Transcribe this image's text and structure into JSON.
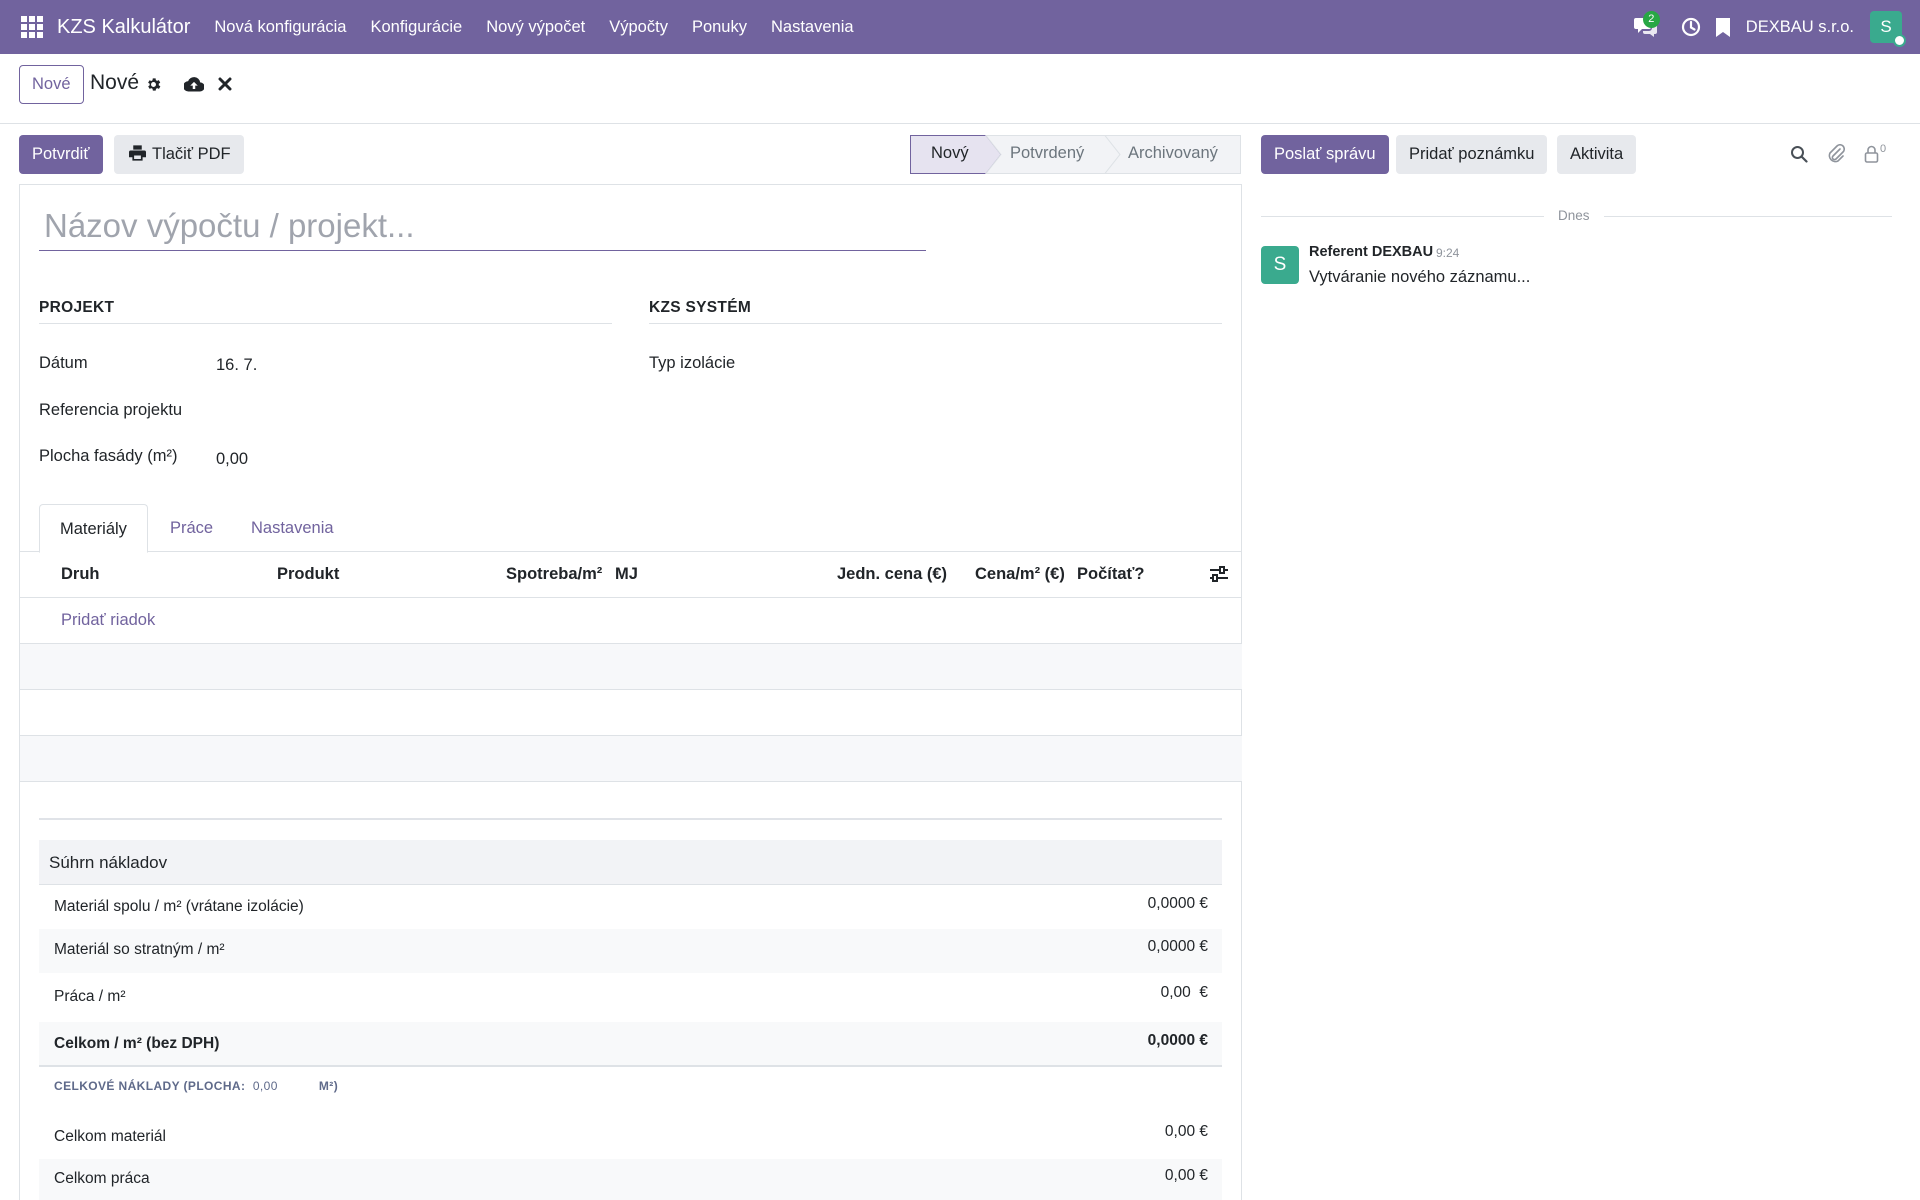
{
  "navbar": {
    "brand": "KZS Kalkulátor",
    "menu": [
      "Nová konfigurácia",
      "Konfigurácie",
      "Nový výpočet",
      "Výpočty",
      "Ponuky",
      "Nastavenia"
    ],
    "messages_count": "2",
    "company": "DEXBAU s.r.o.",
    "user_initial": "S"
  },
  "control_panel": {
    "new_button": "Nové",
    "breadcrumb_title": "Nové"
  },
  "form": {
    "buttons": {
      "confirm": "Potvrdiť",
      "print_pdf": "Tlačiť PDF"
    },
    "statusbar": [
      "Nový",
      "Potvrdený",
      "Archivovaný"
    ],
    "active_status": "Nový",
    "title_placeholder": "Názov výpočtu / projekt...",
    "groups": {
      "project": {
        "title": "Projekt",
        "fields": [
          {
            "label": "Dátum",
            "value": "16. 7."
          },
          {
            "label": "Referencia projektu",
            "value": ""
          },
          {
            "label": "Plocha fasády (m²)",
            "value": "0,00"
          }
        ]
      },
      "kzs_system": {
        "title": "KZS systém",
        "fields": [
          {
            "label": "Typ izolácie",
            "value": ""
          }
        ]
      }
    },
    "tabs": [
      "Materiály",
      "Práce",
      "Nastavenia"
    ],
    "active_tab": "Materiály",
    "table": {
      "columns": [
        "Druh",
        "Produkt",
        "Spotreba/m²",
        "MJ",
        "Jedn. cena (€)",
        "Cena/m² (€)",
        "Počítať?"
      ],
      "add_line": "Pridať riadok"
    },
    "summary": {
      "title": "Súhrn nákladov",
      "rows": [
        {
          "label": "Materiál spolu / m² (vrátane izolácie)",
          "value": "0,0000 €"
        },
        {
          "label": "Materiál so stratným / m²",
          "value": "0,0000 €"
        },
        {
          "label": "Práca / m²",
          "value": "0,00  €"
        },
        {
          "label": "Celkom / m² (bez DPH)",
          "value": "0,0000 €"
        }
      ],
      "total_prefix": "CELKOVÉ NÁKLADY (PLOCHA:",
      "total_area": "0,00",
      "total_suffix": "M²)",
      "totals": [
        {
          "label": "Celkom materiál",
          "value": "0,00 €"
        },
        {
          "label": "Celkom práca",
          "value": "0,00 €"
        }
      ]
    }
  },
  "chatter": {
    "send_message": "Poslať správu",
    "log_note": "Pridať poznámku",
    "activity": "Aktivita",
    "followers_count": "0",
    "day_label": "Dnes",
    "message": {
      "avatar_initial": "S",
      "author": "Referent DEXBAU",
      "time": "9:24",
      "body": "Vytváranie nového záznamu..."
    }
  },
  "colors": {
    "brand_purple": "#71639e",
    "avatar_teal": "#3aaa8e",
    "badge_green": "#28a745"
  },
  "icons": [
    "apps-icon",
    "chat-icon",
    "clock-icon",
    "bookmark-icon",
    "gear-icon",
    "cloud-upload-icon",
    "close-icon",
    "printer-icon",
    "sliders-icon",
    "search-icon",
    "paperclip-icon",
    "lock-icon"
  ]
}
